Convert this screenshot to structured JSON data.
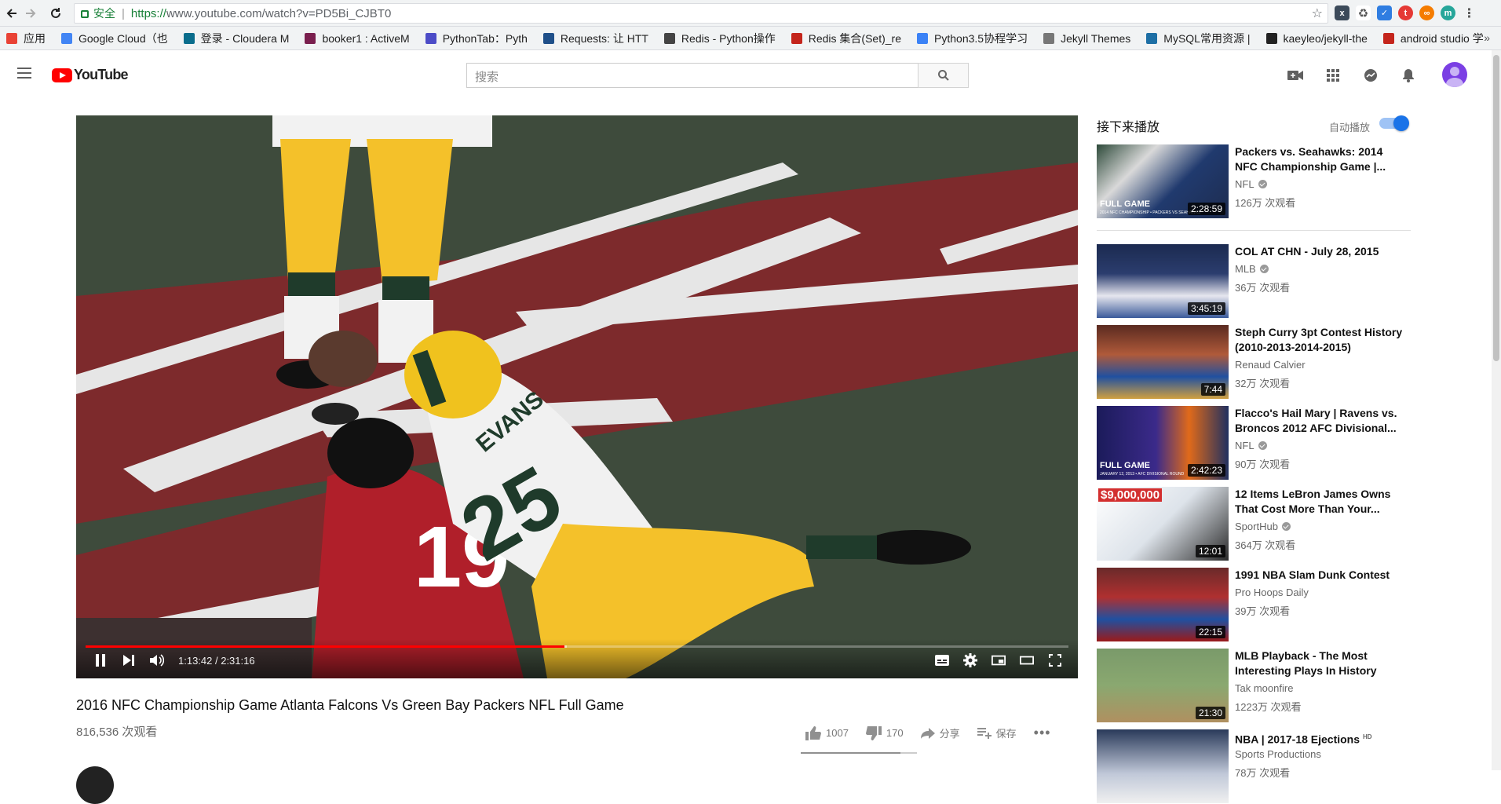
{
  "browser": {
    "secure_label": "安全",
    "url_scheme": "https://",
    "url_rest": "www.youtube.com/watch?v=PD5Bi_CJBT0",
    "bookmarks": [
      {
        "label": "应用",
        "color": "#e94235"
      },
      {
        "label": "Google Cloud（也",
        "color": "#4285f4"
      },
      {
        "label": "登录 - Cloudera M",
        "color": "#0a6d8c"
      },
      {
        "label": "booker1 : ActiveM",
        "color": "#7a1f4e"
      },
      {
        "label": "PythonTab：Pyth",
        "color": "#4c4cc7"
      },
      {
        "label": "Requests: 让 HTT",
        "color": "#1f4f89"
      },
      {
        "label": "Redis - Python操作",
        "color": "#444444"
      },
      {
        "label": "Redis 集合(Set)_re",
        "color": "#c4251c"
      },
      {
        "label": "Python3.5协程学习",
        "color": "#3b82f6"
      },
      {
        "label": "Jekyll Themes",
        "color": "#777777"
      },
      {
        "label": "MySQL常用资源 |",
        "color": "#1d6fa5"
      },
      {
        "label": "kaeyleo/jekyll-the",
        "color": "#222222"
      },
      {
        "label": "android studio 学",
        "color": "#c4251c"
      }
    ],
    "more_label": "»"
  },
  "header": {
    "logo_text": "YouTube",
    "search_placeholder": "搜索"
  },
  "player": {
    "time_current": "1:13:42",
    "time_total": "2:31:16",
    "played_fraction": 0.487,
    "buffered_fraction": 0.49
  },
  "video": {
    "title": "2016 NFC Championship Game Atlanta Falcons Vs Green Bay Packers NFL Full Game",
    "views": "816,536 次观看",
    "likes": "1007",
    "dislikes": "170",
    "share_label": "分享",
    "save_label": "保存",
    "like_ratio": 0.856
  },
  "sidebar": {
    "up_next": "接下来播放",
    "autoplay": "自动播放",
    "items": [
      {
        "title": "Packers vs. Seahawks: 2014 NFC Championship Game |...",
        "channel": "NFL",
        "verified": true,
        "views": "126万 次观看",
        "duration": "2:28:59",
        "hd": false
      },
      {
        "title": "COL AT CHN - July 28, 2015",
        "channel": "MLB",
        "verified": true,
        "views": "36万 次观看",
        "duration": "3:45:19",
        "hd": false
      },
      {
        "title": "Steph Curry 3pt Contest History (2010-2013-2014-2015)",
        "channel": "Renaud Calvier",
        "verified": false,
        "views": "32万 次观看",
        "duration": "7:44",
        "hd": false
      },
      {
        "title": "Flacco's Hail Mary | Ravens vs. Broncos 2012 AFC Divisional...",
        "channel": "NFL",
        "verified": true,
        "views": "90万 次观看",
        "duration": "2:42:23",
        "hd": false
      },
      {
        "title": "12 Items LeBron James Owns That Cost More Than Your...",
        "channel": "SportHub",
        "verified": true,
        "views": "364万 次观看",
        "duration": "12:01",
        "hd": false
      },
      {
        "title": "1991 NBA Slam Dunk Contest",
        "channel": "Pro Hoops Daily",
        "verified": false,
        "views": "39万 次观看",
        "duration": "22:15",
        "hd": false
      },
      {
        "title": "MLB Playback - The Most Interesting Plays In History",
        "channel": "Tak moonfire",
        "verified": false,
        "views": "1223万 次观看",
        "duration": "21:30",
        "hd": false
      },
      {
        "title": "NBA | 2017-18 Ejections",
        "channel": "Sports Productions",
        "verified": false,
        "views": "78万 次观看",
        "duration": "",
        "hd": true
      }
    ],
    "thumb_texts": {
      "full_game": "FULL GAME",
      "nfc_caption": "2014 NFC CHAMPIONSHIP • PACKERS VS SEAHAWKS",
      "afc_caption": "JANUARY 12, 2013 • AFC DIVISIONAL ROUND",
      "price": "$9,000,000",
      "hd": "HD"
    }
  },
  "scene_text": {
    "jersey_name": "EVANS",
    "jersey_number": "25",
    "opponent_number": "19"
  },
  "colors": {
    "accent_red": "#ff0000",
    "toggle_blue": "#1a73e8",
    "secure_green": "#188038"
  }
}
